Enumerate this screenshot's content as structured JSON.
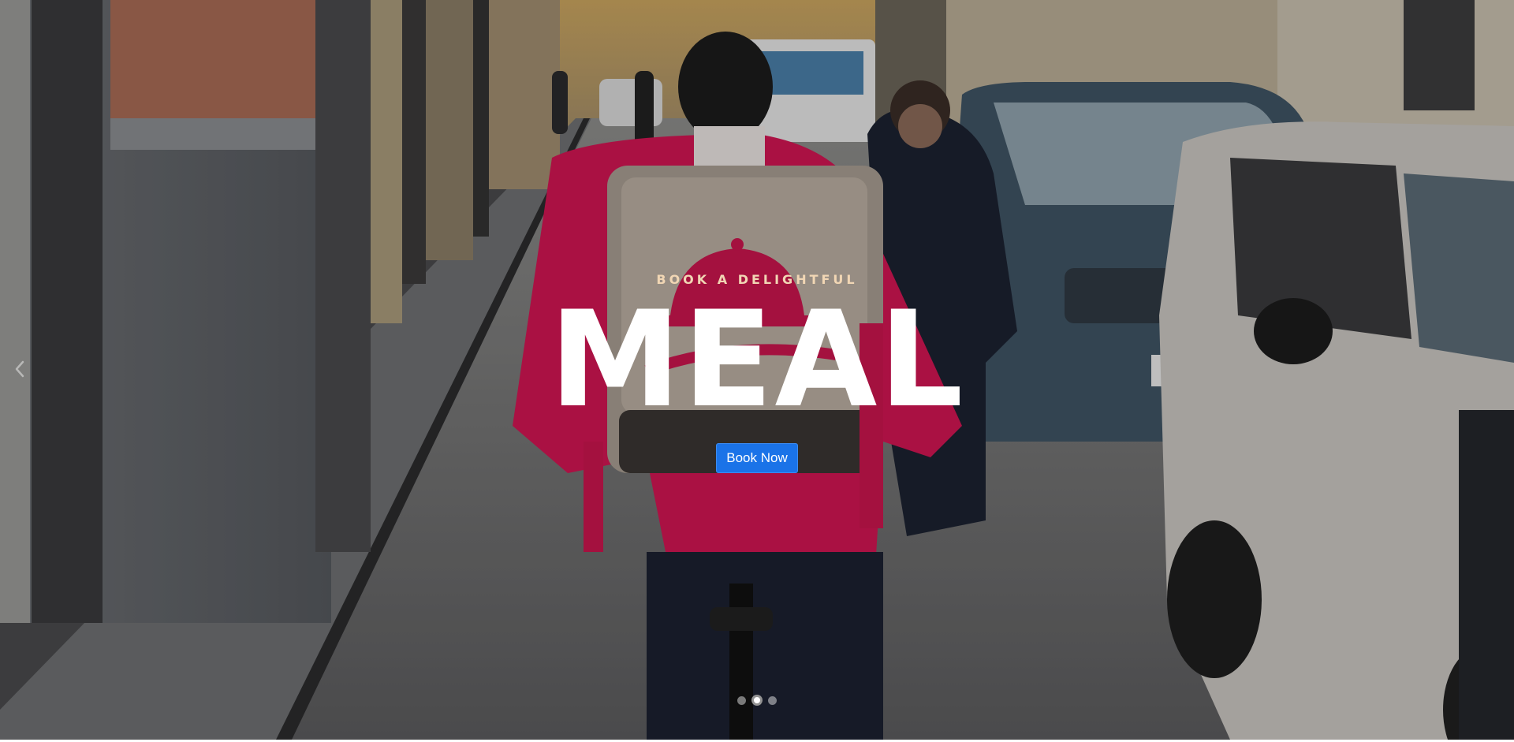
{
  "hero": {
    "eyebrow": "BOOK A DELIGHTFUL",
    "headline": "MEAL",
    "cta_label": "Book Now",
    "background_description_icon": "street-delivery-photo",
    "accent_color": "#1a73e8"
  },
  "carousel": {
    "slide_count": 3,
    "active_index": 1,
    "prev_icon": "chevron-left-icon"
  }
}
